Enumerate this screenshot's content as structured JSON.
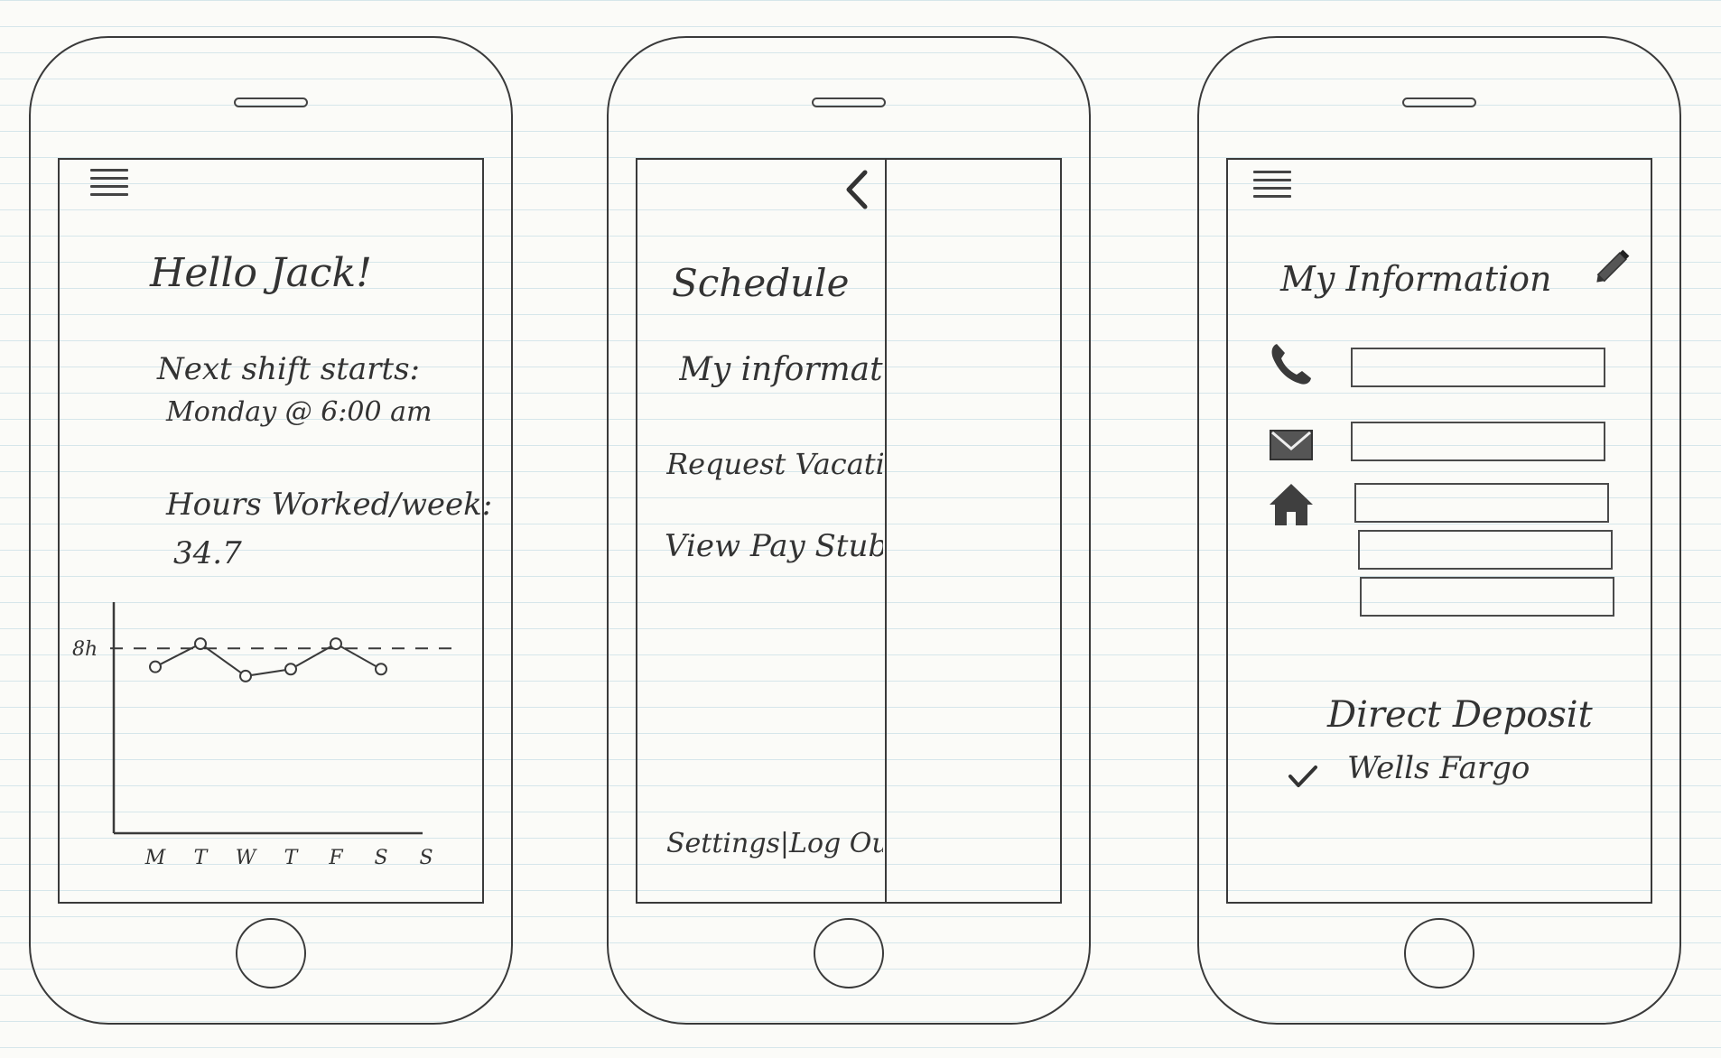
{
  "home_screen": {
    "greeting": "Hello Jack!",
    "next_shift_label": "Next shift starts:",
    "next_shift_value": "Monday @ 6:00 am",
    "hours_label": "Hours Worked/week:",
    "hours_value": "34.7",
    "menu_icon": "hamburger-menu-icon"
  },
  "chart_data": {
    "type": "line",
    "categories": [
      "M",
      "T",
      "W",
      "T",
      "F",
      "S",
      "S"
    ],
    "values": [
      7.2,
      8.2,
      6.8,
      7.1,
      8.2,
      7.1
    ],
    "reference_line": {
      "value": 8,
      "label": "8h",
      "style": "dashed"
    },
    "ylim": [
      0,
      10
    ],
    "title": "",
    "xlabel": "",
    "ylabel": ""
  },
  "nav_drawer": {
    "back_icon": "chevron-left-icon",
    "items": [
      {
        "label": "Schedule"
      },
      {
        "label": "My information"
      },
      {
        "label": "Request Vacation"
      },
      {
        "label": "View Pay Stubs"
      }
    ],
    "footer_label": "Settings|Log Out"
  },
  "info_screen": {
    "title": "My Information",
    "edit_icon": "pencil-icon",
    "menu_icon": "hamburger-menu-icon",
    "phone_icon": "phone-icon",
    "email_icon": "envelope-icon",
    "address_icon": "house-icon",
    "phone_value": "",
    "email_value": "",
    "address_line1": "",
    "address_line2": "",
    "address_line3": "",
    "direct_deposit_label": "Direct Deposit",
    "direct_deposit_bank": "Wells Fargo",
    "check_icon": "checkmark-icon"
  }
}
